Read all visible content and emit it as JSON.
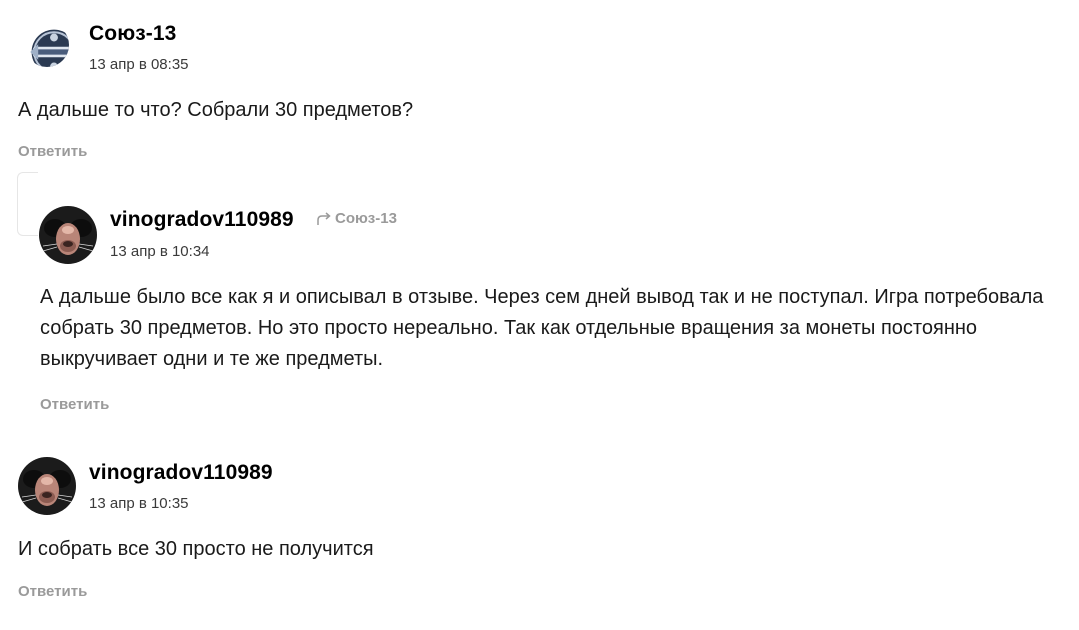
{
  "comments": [
    {
      "author": "Союз-13",
      "date": "13 апр в 08:35",
      "text": "А дальше то что? Собрали 30 предметов?",
      "reply_label": "Ответить"
    },
    {
      "author": "vinogradov110989",
      "reply_to": "Союз-13",
      "date": "13 апр в 10:34",
      "text": "А дальше было все как я и описывал в отзыве. Через сем дней вывод так и не поступал. Игра потребовала собрать 30 предметов. Но это просто нереально. Так как отдельные вращения за монеты постоянно выкручивает одни и те же предметы.",
      "reply_label": "Ответить"
    },
    {
      "author": "vinogradov110989",
      "date": "13 апр в 10:35",
      "text": "И собрать все 30 просто не получится",
      "reply_label": "Ответить"
    }
  ],
  "icons": {
    "reply_arrow": "reply-arrow-icon"
  },
  "colors": {
    "muted": "#9a9a9a",
    "text": "#1a1a1a"
  }
}
